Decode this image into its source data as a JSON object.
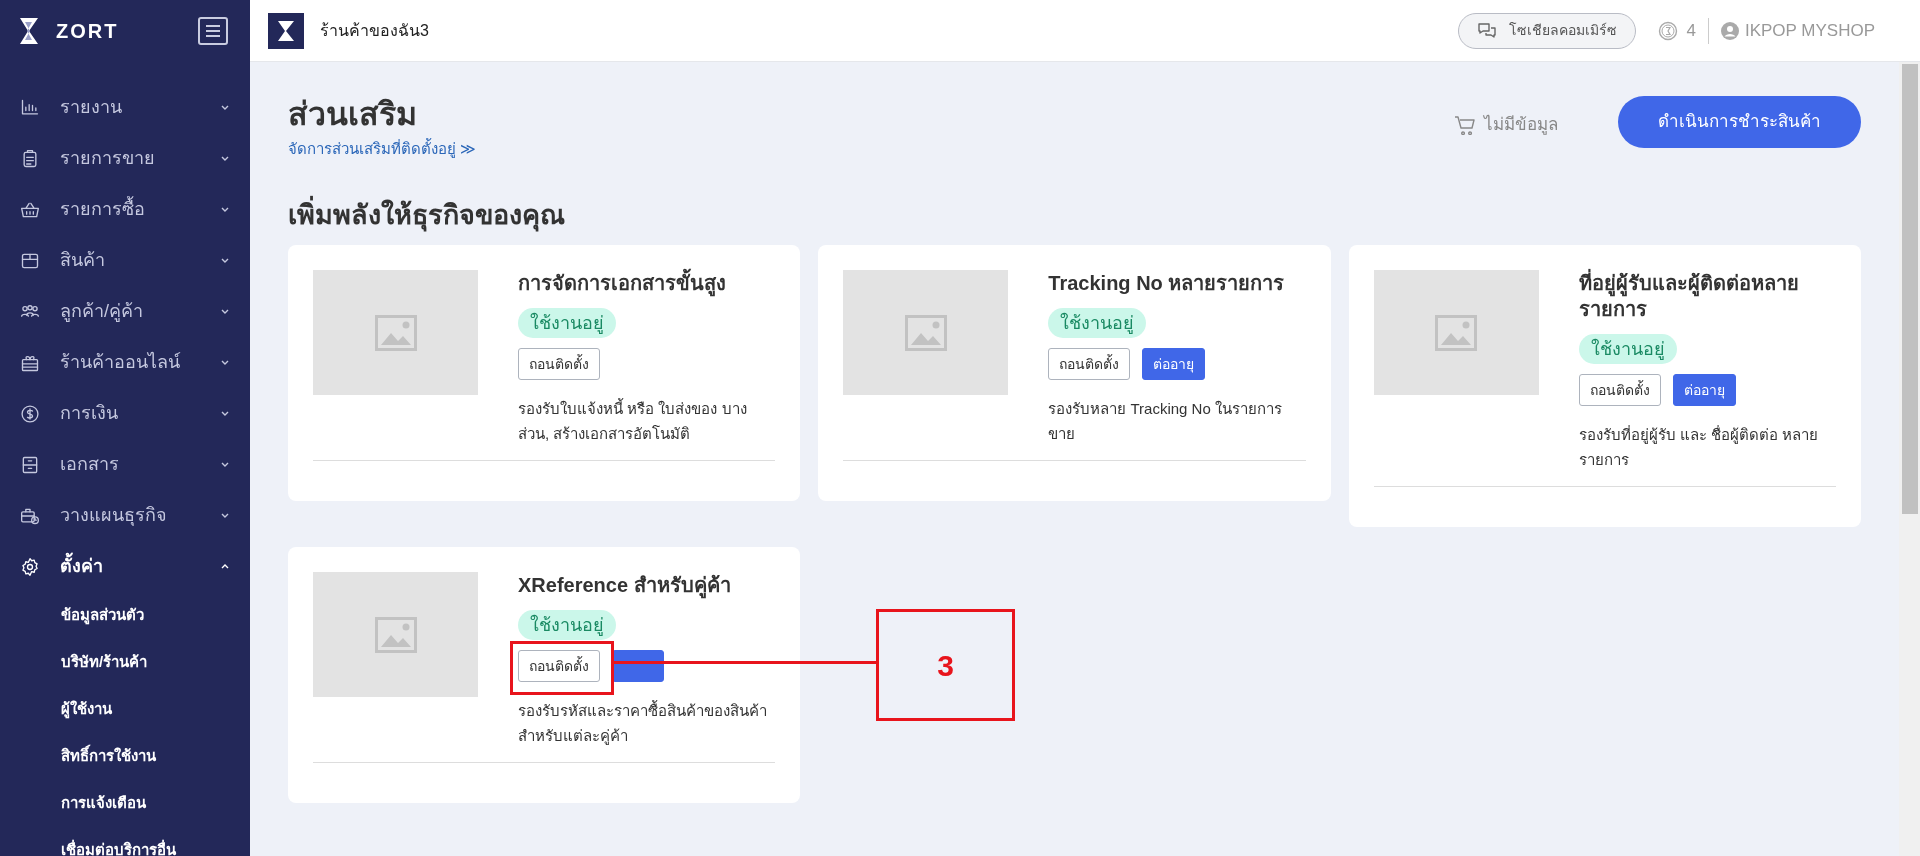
{
  "sidebar": {
    "logo": "ZORT",
    "items": [
      {
        "label": "รายงาน",
        "expanded": false
      },
      {
        "label": "รายการขาย",
        "expanded": false
      },
      {
        "label": "รายการซื้อ",
        "expanded": false
      },
      {
        "label": "สินค้า",
        "expanded": false
      },
      {
        "label": "ลูกค้า/คู่ค้า",
        "expanded": false
      },
      {
        "label": "ร้านค้าออนไลน์",
        "expanded": false
      },
      {
        "label": "การเงิน",
        "expanded": false
      },
      {
        "label": "เอกสาร",
        "expanded": false
      },
      {
        "label": "วางแผนธุรกิจ",
        "expanded": false
      },
      {
        "label": "ตั้งค่า",
        "expanded": true,
        "children": [
          "ข้อมูลส่วนตัว",
          "บริษัท/ร้านค้า",
          "ผู้ใช้งาน",
          "สิทธิ์การใช้งาน",
          "การแจ้งเตือน",
          "เชื่อมต่อบริการอื่น"
        ]
      }
    ]
  },
  "top_bar": {
    "shop_name": "ร้านค้าของฉัน3",
    "social_button": "โซเชียลคอมเมิร์ซ",
    "count": "4",
    "user": "IKPOP MYSHOP"
  },
  "header": {
    "title": "ส่วนเสริม",
    "manage_link": "จัดการส่วนเสริมที่ติดตั้งอยู่ ≫",
    "cart": "ไม่มีข้อมูล",
    "checkout_button": "ดำเนินการชำระสินค้า"
  },
  "section_title": "เพิ่มพลังให้ธุรกิจของคุณ",
  "cards": [
    {
      "title": "การจัดการเอกสารขั้นสูง",
      "status": "ใช้งานอยู่",
      "buttons": [
        {
          "label": "ถอนติดตั้ง",
          "kind": "outline"
        }
      ],
      "description": "รองรับใบแจ้งหนี้ หรือ ใบส่งของ บางส่วน, สร้างเอกสารอัตโนมัติ"
    },
    {
      "title": "Tracking No หลายรายการ",
      "status": "ใช้งานอยู่",
      "buttons": [
        {
          "label": "ถอนติดตั้ง",
          "kind": "outline"
        },
        {
          "label": "ต่ออายุ",
          "kind": "primary"
        }
      ],
      "description": "รองรับหลาย Tracking No ในรายการขาย"
    },
    {
      "title": "ที่อยู่ผู้รับและผู้ติดต่อหลายรายการ",
      "status": "ใช้งานอยู่",
      "buttons": [
        {
          "label": "ถอนติดตั้ง",
          "kind": "outline"
        },
        {
          "label": "ต่ออายุ",
          "kind": "primary"
        }
      ],
      "description": "รองรับที่อยู่ผู้รับ และ ชื่อผู้ติดต่อ หลายรายการ"
    },
    {
      "title": "XReference สำหรับคู่ค้า",
      "status": "ใช้งานอยู่",
      "buttons": [
        {
          "label": "ถอนติดตั้ง",
          "kind": "outline"
        },
        {
          "kind": "primary"
        }
      ],
      "description": "รองรับรหัสและราคาซื้อสินค้าของสินค้าสำหรับแต่ละคู่ค้า"
    }
  ],
  "annotation": {
    "label": "3"
  }
}
